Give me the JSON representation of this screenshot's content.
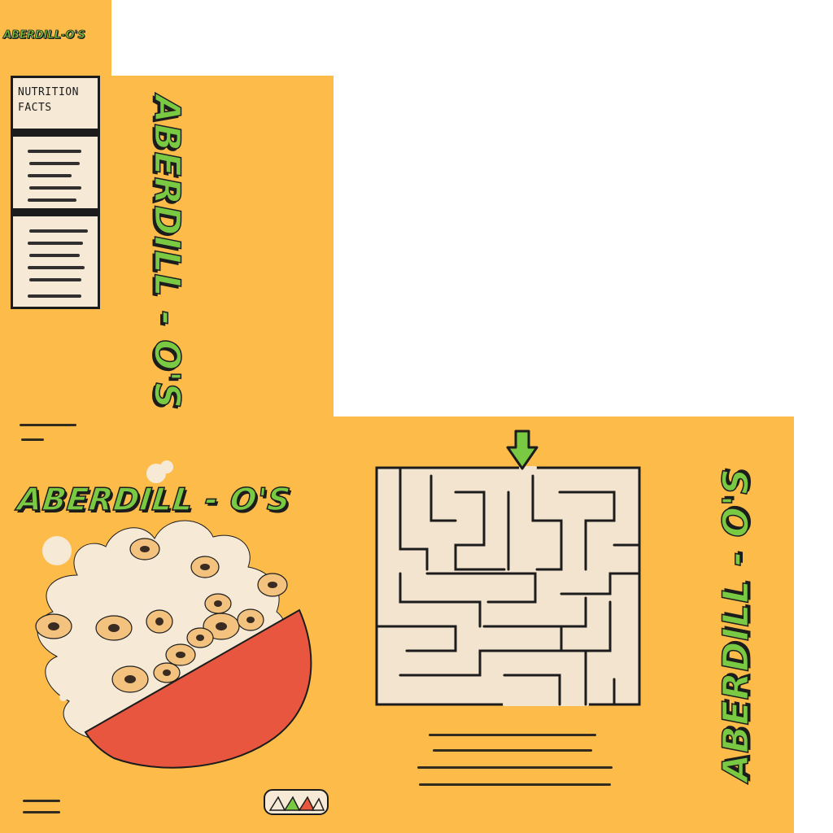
{
  "brand": {
    "name": "ABERDILL-O'S",
    "name_spaced": "ABERDILL - O'S"
  },
  "nutrition": {
    "title_line1": "NUTRITION",
    "title_line2": "FACTS"
  },
  "colors": {
    "box": "#FDBC4A",
    "logo": "#7AC943",
    "bowl": "#E8563F",
    "milk": "#F6E9D6",
    "cereal": "#F2C27E",
    "outline": "#1c1c1c",
    "maze_bg": "#F3E4CF"
  },
  "icons": {
    "maze_start": "arrow-down-icon",
    "badge": "recycle-badge-icon"
  }
}
